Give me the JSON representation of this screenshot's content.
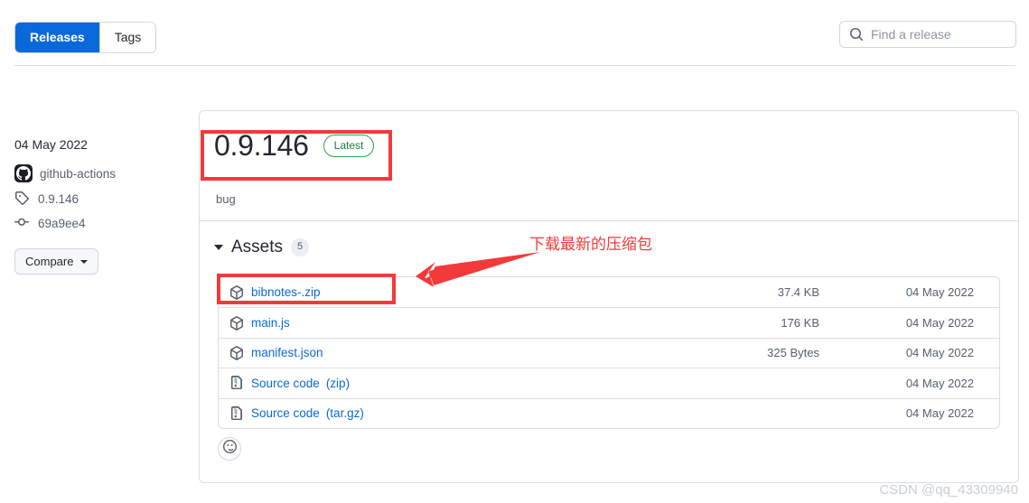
{
  "tabs": [
    {
      "label": "Releases",
      "selected": true
    },
    {
      "label": "Tags",
      "selected": false
    }
  ],
  "search": {
    "placeholder": "Find a release",
    "value": "",
    "icon": "search-icon"
  },
  "sidebar": {
    "date": "04 May 2022",
    "author": "github-actions",
    "author_icon": "github-mark-icon",
    "tag": "0.9.146",
    "tag_icon": "tag-icon",
    "commit": "69a9ee4",
    "commit_icon": "commit-icon",
    "compare_label": "Compare"
  },
  "release": {
    "version": "0.9.146",
    "badge": "Latest",
    "body": "bug"
  },
  "assets": {
    "title": "Assets",
    "count": "5",
    "columns": [
      "name",
      "size",
      "date"
    ],
    "rows": [
      {
        "icon": "package-icon",
        "name": "bibnotes-.zip",
        "sub": "",
        "size": "37.4 KB",
        "date": "04 May 2022",
        "highlighted": true
      },
      {
        "icon": "package-icon",
        "name": "main.js",
        "sub": "",
        "size": "176 KB",
        "date": "04 May 2022",
        "highlighted": false
      },
      {
        "icon": "package-icon",
        "name": "manifest.json",
        "sub": "",
        "size": "325 Bytes",
        "date": "04 May 2022",
        "highlighted": false
      },
      {
        "icon": "file-zip-icon",
        "name": "Source code",
        "sub": "(zip)",
        "size": "",
        "date": "04 May 2022",
        "highlighted": false
      },
      {
        "icon": "file-zip-icon",
        "name": "Source code",
        "sub": "(tar.gz)",
        "size": "",
        "date": "04 May 2022",
        "highlighted": false
      }
    ]
  },
  "reaction": {
    "icon": "smiley-icon"
  },
  "annotations": {
    "note": "下载最新的压缩包",
    "color": "#f4393b"
  },
  "watermark": "CSDN @qq_43309940",
  "colors": {
    "accent_blue": "#0969da",
    "link_blue": "#0969da",
    "badge_green": "#2da44e",
    "annotation_red": "#f4393b",
    "border_gray": "#d8dee4",
    "muted_text": "#57606a"
  }
}
